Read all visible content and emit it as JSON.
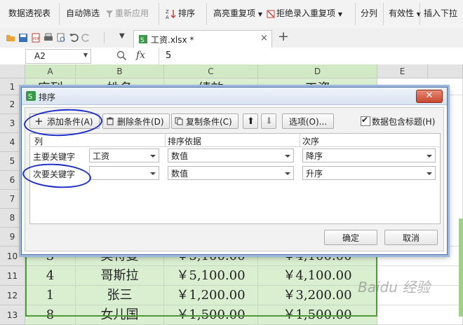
{
  "ribbon": {
    "pivot": "数据透视表",
    "autofilter": "自动筛选",
    "reapply": "重新应用",
    "sort": "排序",
    "highlight_dup": "高亮重复项",
    "reject_dup": "拒绝录入重复项",
    "split": "分列",
    "validity": "有效性",
    "insert_dropdown": "插入下拉"
  },
  "qat": {
    "file_tab": "工资.xlsx *",
    "add_tab": "+"
  },
  "formula_bar": {
    "cell_ref": "A2",
    "fx": "fx",
    "value": "5"
  },
  "grid": {
    "columns": [
      "A",
      "B",
      "C",
      "D",
      "E"
    ],
    "rows": [
      "1",
      "2",
      "3",
      "4",
      "5",
      "6",
      "7",
      "8",
      "9",
      "10",
      "11",
      "12",
      "13"
    ],
    "header_row": [
      "序列",
      "姓名",
      "绩效",
      "工资"
    ],
    "visible_rows": [
      [
        "3",
        "奥特曼",
        "￥5,100.00",
        "￥4,100.00"
      ],
      [
        "4",
        "哥斯拉",
        "￥5,100.00",
        "￥4,100.00"
      ],
      [
        "1",
        "张三",
        "￥1,200.00",
        "￥3,200.00"
      ],
      [
        "8",
        "女儿国",
        "￥1,500.00",
        "￥1,500.00"
      ]
    ]
  },
  "dialog": {
    "title": "排序",
    "add_condition": "添加条件(A)",
    "delete_condition": "删除条件(D)",
    "copy_condition": "复制条件(C)",
    "options": "选项(O)...",
    "has_header": "数据包含标题(H)",
    "has_header_checked": true,
    "col_header": "列",
    "basis_header": "排序依据",
    "order_header": "次序",
    "conditions": [
      {
        "label": "主要关键字",
        "column": "工资",
        "basis": "数值",
        "order": "降序"
      },
      {
        "label": "次要关键字",
        "column": "",
        "basis": "数值",
        "order": "升序"
      }
    ],
    "ok": "确定",
    "cancel": "取消"
  },
  "watermark": "Baidu 经验",
  "colors": {
    "selection_green": "#d9efd0",
    "ink_blue": "#1a2cc9",
    "dialog_border": "#4b70a8"
  }
}
